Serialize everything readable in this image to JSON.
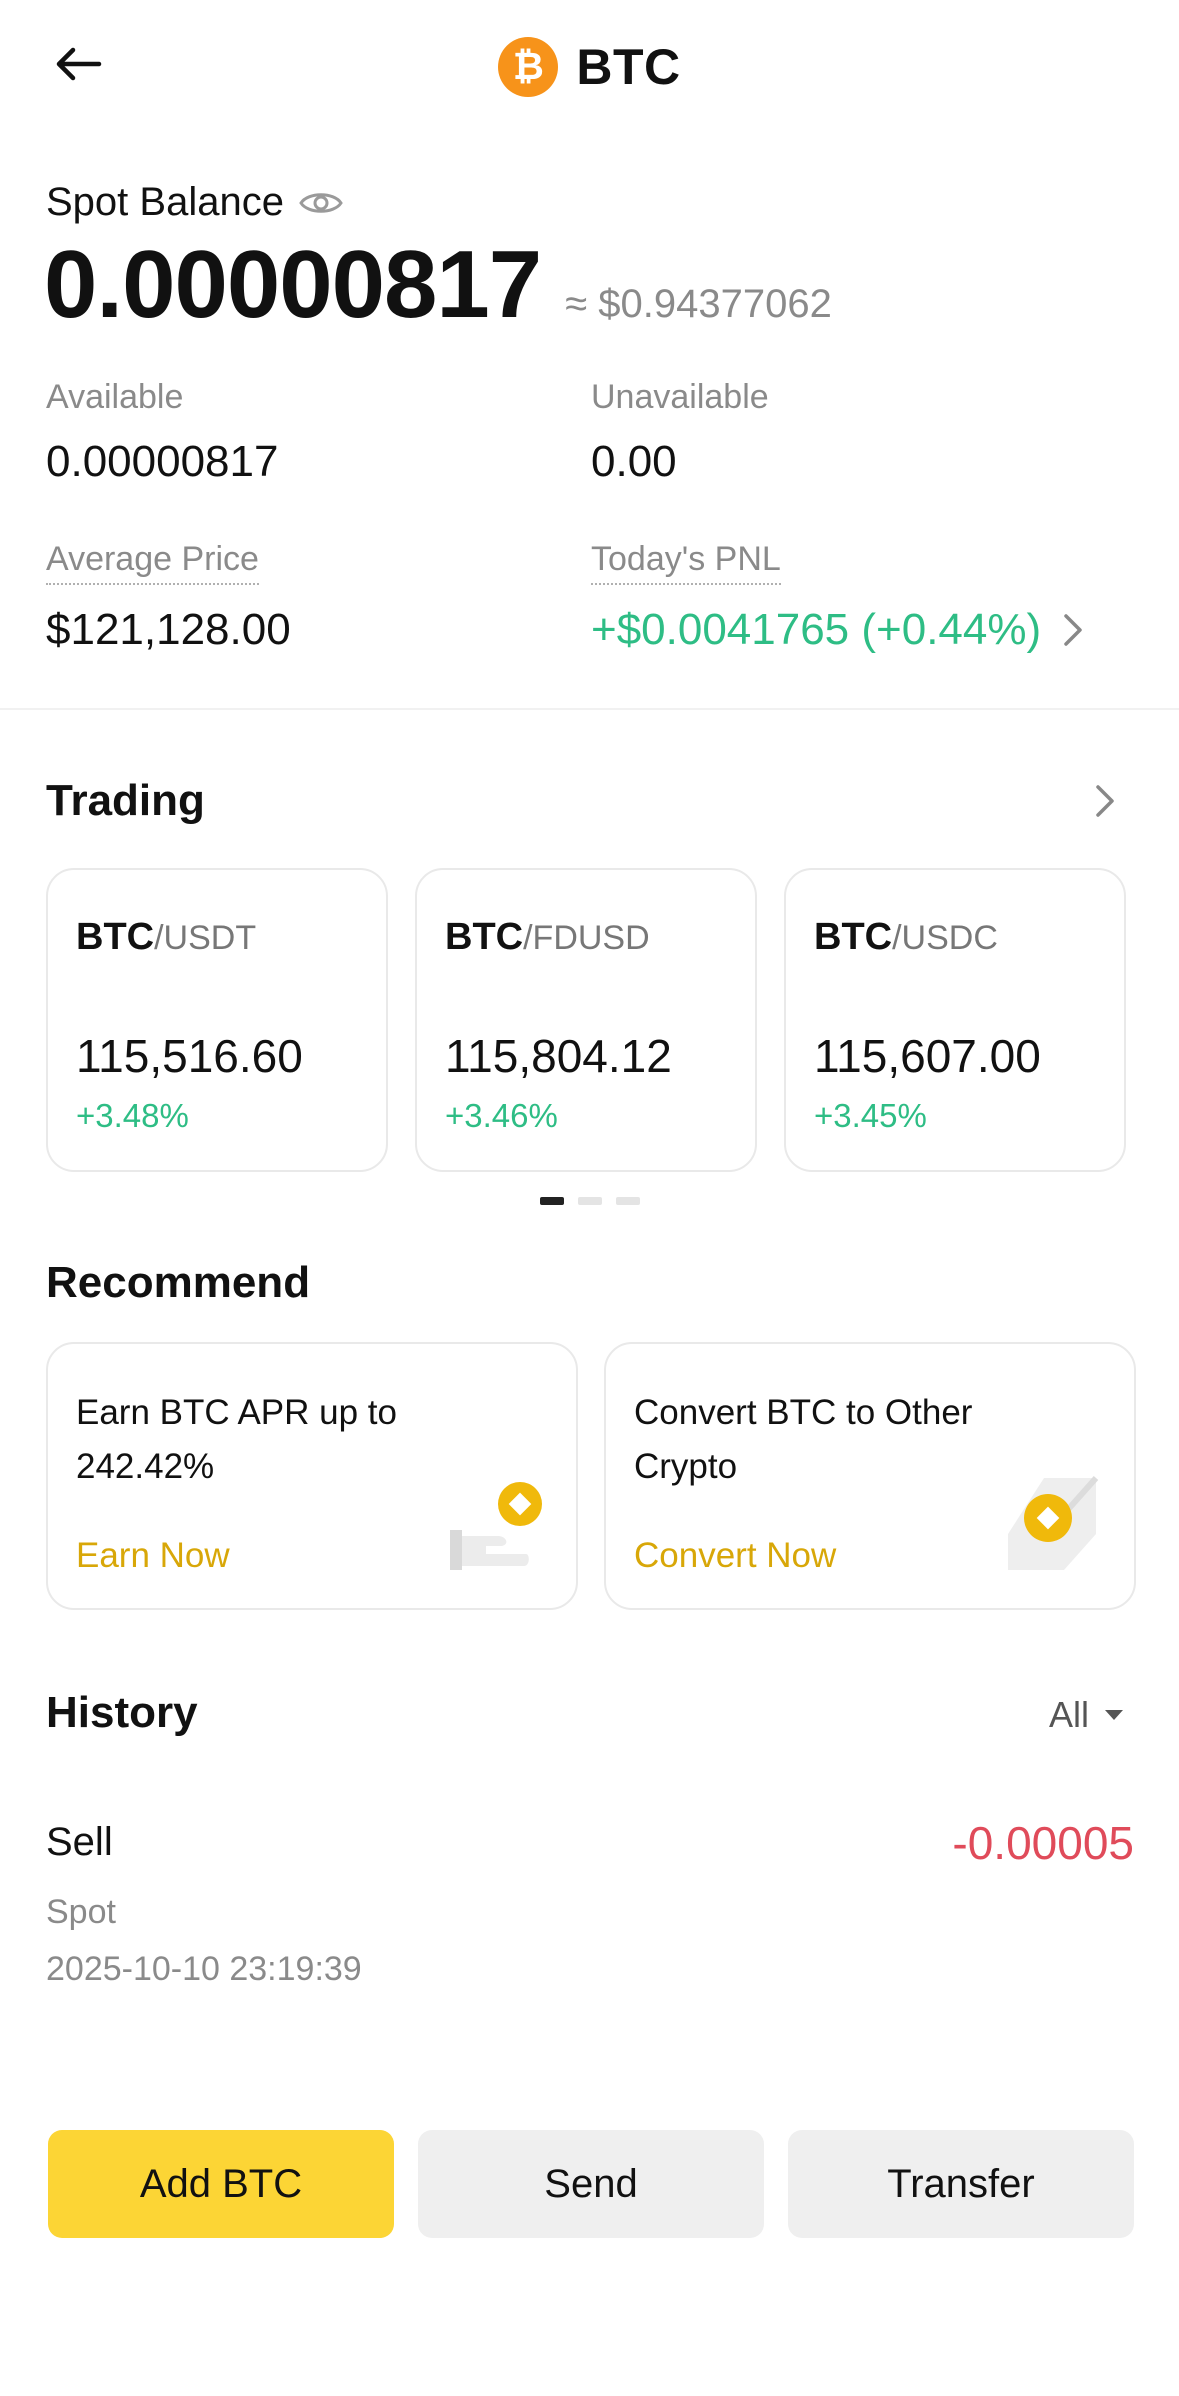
{
  "header": {
    "title": "BTC",
    "coin_symbol": "₿",
    "coin_color": "#F7931A"
  },
  "balance": {
    "label": "Spot Balance",
    "amount": "0.00000817",
    "fiat": "≈ $0.94377062"
  },
  "stats": {
    "available": {
      "label": "Available",
      "value": "0.00000817"
    },
    "unavailable": {
      "label": "Unavailable",
      "value": "0.00"
    },
    "average_price": {
      "label": "Average Price",
      "value": "$121,128.00"
    },
    "todays_pnl": {
      "label": "Today's PNL",
      "value": "+$0.0041765 (+0.44%)"
    }
  },
  "trading": {
    "title": "Trading",
    "pairs": [
      {
        "base": "BTC",
        "quote": "/USDT",
        "price": "115,516.60",
        "change": "+3.48%"
      },
      {
        "base": "BTC",
        "quote": "/FDUSD",
        "price": "115,804.12",
        "change": "+3.46%"
      },
      {
        "base": "BTC",
        "quote": "/USDC",
        "price": "115,607.00",
        "change": "+3.45%"
      }
    ]
  },
  "recommend": {
    "title": "Recommend",
    "cards": [
      {
        "text": "Earn BTC APR up to 242.42%",
        "action": "Earn Now"
      },
      {
        "text": "Convert BTC to Other Crypto",
        "action": "Convert Now"
      }
    ]
  },
  "history": {
    "title": "History",
    "filter": "All",
    "items": [
      {
        "type": "Sell",
        "amount": "-0.00005",
        "market": "Spot",
        "time": "2025-10-10 23:19:39"
      }
    ]
  },
  "actions": {
    "add": "Add BTC",
    "send": "Send",
    "transfer": "Transfer"
  },
  "colors": {
    "accent_yellow": "#FCD535",
    "positive": "#2EBD85",
    "negative": "#E04B5A",
    "link_gold": "#D8A708"
  }
}
